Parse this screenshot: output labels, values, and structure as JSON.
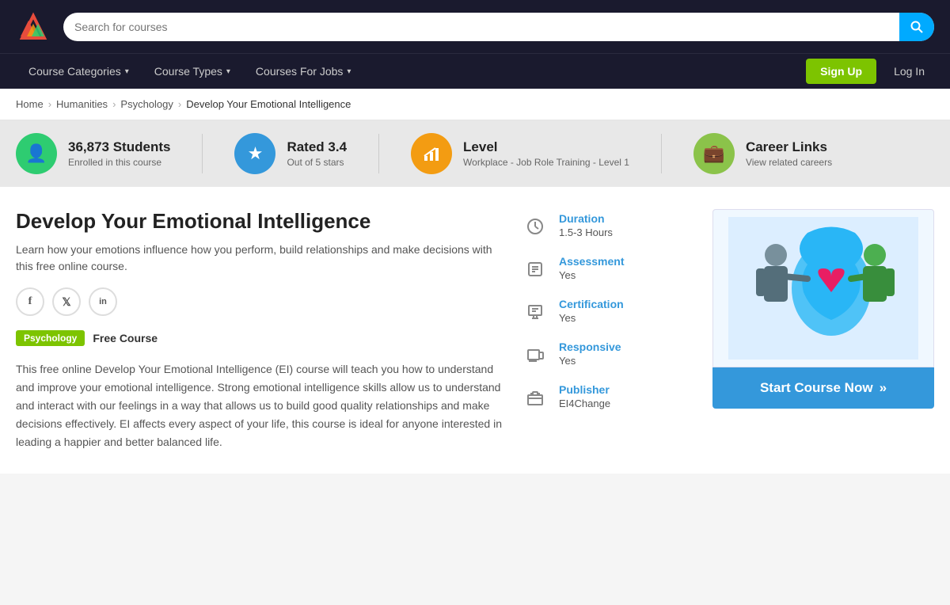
{
  "header": {
    "search_placeholder": "Search for courses",
    "search_icon": "🔍"
  },
  "nav": {
    "links": [
      {
        "label": "Course Categories",
        "id": "course-categories"
      },
      {
        "label": "Course Types",
        "id": "course-types"
      },
      {
        "label": "Courses For Jobs",
        "id": "courses-for-jobs"
      }
    ],
    "signup_label": "Sign Up",
    "login_label": "Log In"
  },
  "breadcrumb": {
    "items": [
      "Home",
      "Humanities",
      "Psychology",
      "Develop Your Emotional Intelligence"
    ]
  },
  "stats": [
    {
      "icon": "👤",
      "icon_class": "icon-green",
      "title": "36,873 Students",
      "sub": "Enrolled in this course",
      "id": "students"
    },
    {
      "icon": "★",
      "icon_class": "icon-blue",
      "title": "Rated 3.4",
      "sub": "Out of 5 stars",
      "id": "rating"
    },
    {
      "icon": "📊",
      "icon_class": "icon-orange",
      "title": "Level",
      "sub": "Workplace - Job Role Training - Level 1",
      "id": "level"
    },
    {
      "icon": "💼",
      "icon_class": "icon-lime",
      "title": "Career Links",
      "sub": "View related careers",
      "id": "careers"
    }
  ],
  "course": {
    "title": "Develop Your Emotional Intelligence",
    "short_description": "Learn how your emotions influence how you perform, build relationships and make decisions with this free online course.",
    "tag_psychology": "Psychology",
    "tag_free": "Free Course",
    "long_description": "This free online Develop Your Emotional Intelligence (EI) course will teach you how to understand and improve your emotional intelligence. Strong emotional intelligence skills allow us to understand and interact with our feelings in a way that allows us to build good quality relationships and make decisions effectively. EI affects every aspect of your life, this course is ideal for anyone interested in leading a happier and better balanced life.",
    "social": [
      {
        "label": "f",
        "id": "facebook"
      },
      {
        "label": "t",
        "id": "twitter"
      },
      {
        "label": "in",
        "id": "linkedin"
      }
    ]
  },
  "info_items": [
    {
      "icon": "🕐",
      "label": "Duration",
      "value": "1.5-3 Hours",
      "id": "duration"
    },
    {
      "icon": "🖥",
      "label": "Assessment",
      "value": "Yes",
      "id": "assessment"
    },
    {
      "icon": "📋",
      "label": "Certification",
      "value": "Yes",
      "id": "certification"
    },
    {
      "icon": "📱",
      "label": "Responsive",
      "value": "Yes",
      "id": "responsive"
    },
    {
      "icon": "🏛",
      "label": "Publisher",
      "value": "EI4Change",
      "id": "publisher"
    }
  ],
  "cta": {
    "start_label": "Start Course Now",
    "arrows": "»"
  },
  "colors": {
    "accent_blue": "#3498db",
    "accent_green": "#7dc400",
    "nav_bg": "#1a1a2e"
  }
}
